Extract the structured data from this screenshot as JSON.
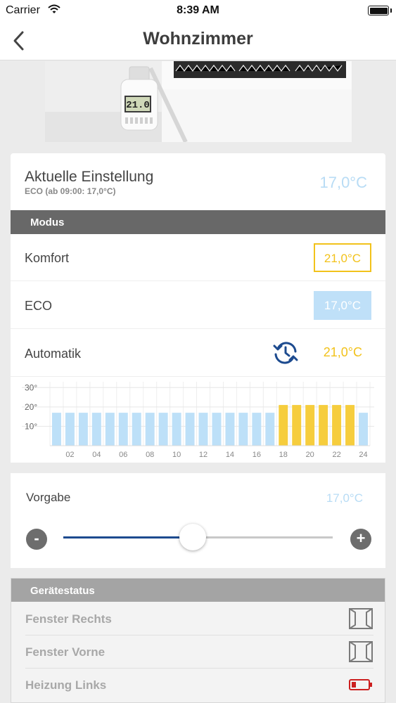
{
  "status_bar": {
    "carrier": "Carrier",
    "time": "8:39 AM"
  },
  "nav": {
    "title": "Wohnzimmer"
  },
  "hero": {
    "thermostat_display": "21.0"
  },
  "current": {
    "title": "Aktuelle Einstellung",
    "subtitle": "ECO (ab 09:00: 17,0°C)",
    "temperature": "17,0°C"
  },
  "modus": {
    "header": "Modus",
    "komfort": {
      "label": "Komfort",
      "value": "21,0°C"
    },
    "eco": {
      "label": "ECO",
      "value": "17,0°C"
    },
    "automatik": {
      "label": "Automatik",
      "value": "21,0°C"
    }
  },
  "chart_data": {
    "type": "bar",
    "y_tick_labels": [
      "30°",
      "20°",
      "10°"
    ],
    "y_ticks": [
      30,
      20,
      10
    ],
    "ylim": [
      0,
      33
    ],
    "x_tick_labels": [
      "02",
      "04",
      "06",
      "08",
      "10",
      "12",
      "14",
      "16",
      "18",
      "20",
      "22",
      "24"
    ],
    "values": [
      17,
      17,
      17,
      17,
      17,
      17,
      17,
      17,
      17,
      17,
      17,
      17,
      17,
      17,
      17,
      17,
      17,
      21,
      21,
      21,
      21,
      21,
      21,
      17
    ],
    "colors": {
      "eco": "#bde0f8",
      "komfort": "#f6cd3d"
    }
  },
  "vorgabe": {
    "label": "Vorgabe",
    "value": "17,0°C",
    "minus": "-",
    "plus": "+",
    "slider_fraction": 0.48
  },
  "geraetestatus": {
    "header": "Gerätestatus",
    "items": [
      {
        "label": "Fenster Rechts",
        "icon": "window-icon"
      },
      {
        "label": "Fenster Vorne",
        "icon": "window-icon"
      },
      {
        "label": "Heizung Links",
        "icon": "battery-low-icon"
      }
    ]
  },
  "colors": {
    "accent_yellow": "#f2c21b",
    "accent_blue": "#bfe0f8",
    "slider_blue": "#1d4b8f",
    "header_gray": "#686868"
  }
}
